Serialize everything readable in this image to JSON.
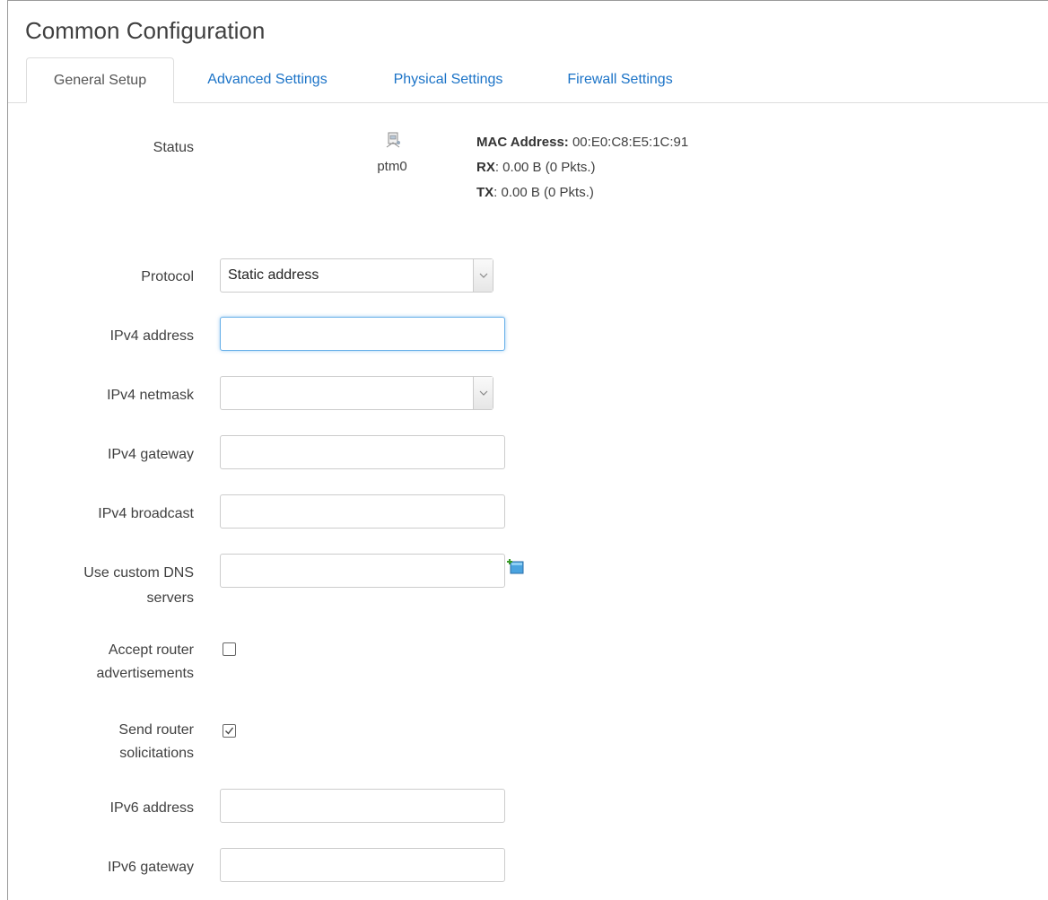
{
  "page": {
    "title": "Common Configuration"
  },
  "tabs": [
    {
      "label": "General Setup",
      "active": true
    },
    {
      "label": "Advanced Settings",
      "active": false
    },
    {
      "label": "Physical Settings",
      "active": false
    },
    {
      "label": "Firewall Settings",
      "active": false
    }
  ],
  "status": {
    "label": "Status",
    "interface_icon": "network-port-icon",
    "interface_name": "ptm0",
    "mac_label": "MAC Address:",
    "mac_value": "00:E0:C8:E5:1C:91",
    "rx_label": "RX",
    "rx_value": ": 0.00 B (0 Pkts.)",
    "tx_label": "TX",
    "tx_value": ": 0.00 B (0 Pkts.)"
  },
  "fields": {
    "protocol": {
      "label": "Protocol",
      "value": "Static address"
    },
    "ipv4_address": {
      "label": "IPv4 address",
      "value": ""
    },
    "ipv4_netmask": {
      "label": "IPv4 netmask",
      "value": ""
    },
    "ipv4_gateway": {
      "label": "IPv4 gateway",
      "value": ""
    },
    "ipv4_broadcast": {
      "label": "IPv4 broadcast",
      "value": ""
    },
    "custom_dns": {
      "label_line1": "Use custom DNS",
      "label_line2": "servers",
      "value": "",
      "add_icon": "add-entry-icon"
    },
    "accept_ra": {
      "label_line1": "Accept router",
      "label_line2": "advertisements",
      "checked": false
    },
    "send_rs": {
      "label_line1": "Send router",
      "label_line2": "solicitations",
      "checked": true
    },
    "ipv6_address": {
      "label": "IPv6 address",
      "value": ""
    },
    "ipv6_gateway": {
      "label": "IPv6 gateway",
      "value": ""
    }
  },
  "colors": {
    "link": "#1b73c7",
    "focus": "#66afe9"
  }
}
